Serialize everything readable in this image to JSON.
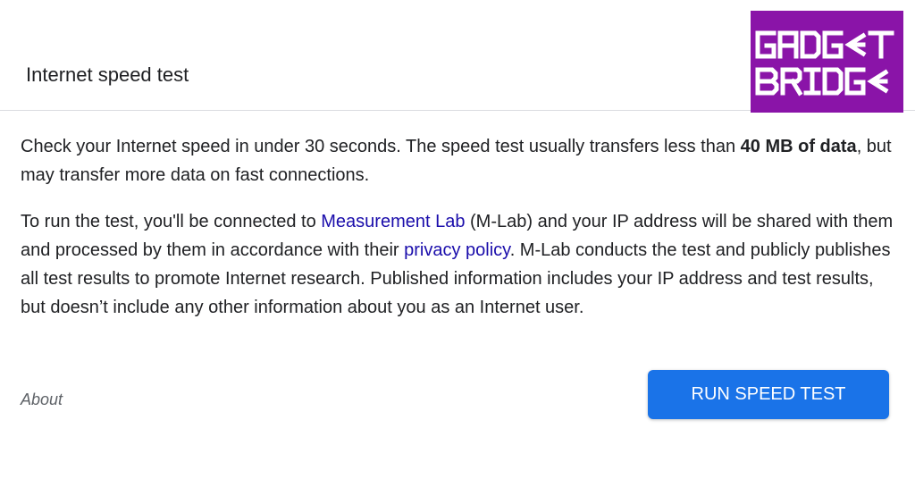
{
  "header": {
    "title": "Internet speed test"
  },
  "logo": {
    "line1": "GADG⌂T",
    "line2": "BRIDG⌂",
    "text": "GADGET BRIDGE",
    "background_color": "#8a14a8",
    "foreground_color": "#ffffff"
  },
  "content": {
    "p1_text1": "Check your Internet speed in under 30 seconds. The speed test usually transfers less than ",
    "p1_bold": "40 MB of data",
    "p1_text2": ", but may transfer more data on fast connections.",
    "p2_text1": "To run the test, you'll be connected to ",
    "p2_link1": "Measurement Lab",
    "p2_text2": " (M-Lab) and your IP address will be shared with them and processed by them in accordance with their ",
    "p2_link2": "privacy policy",
    "p2_text3": ". M-Lab conducts the test and publicly publishes all test results to promote Internet research. Published information includes your IP address and test results, but doesn’t include any other information about you as an Internet user."
  },
  "footer": {
    "about_label": "About",
    "run_button_label": "RUN SPEED TEST"
  },
  "colors": {
    "button": "#1a73e8",
    "link": "#1a0dab",
    "divider": "#dadce0"
  }
}
